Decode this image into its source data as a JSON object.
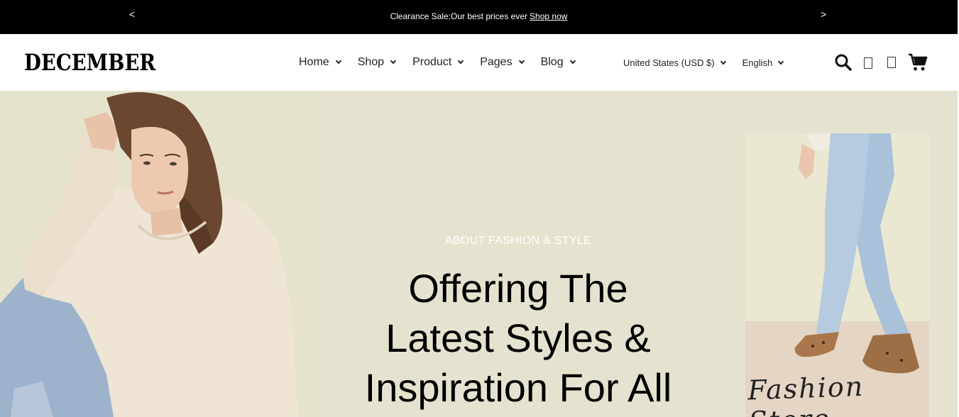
{
  "announcement": {
    "prev_label": "<",
    "next_label": ">",
    "message": "Clearance Sale:Our best prices ever",
    "link": "Shop now"
  },
  "header": {
    "logo": "DECEMBER",
    "nav": [
      {
        "label": "Home"
      },
      {
        "label": "Shop"
      },
      {
        "label": "Product"
      },
      {
        "label": "Pages"
      },
      {
        "label": "Blog"
      }
    ],
    "currency": "United States (USD $)",
    "language": "English",
    "icons": [
      "search-icon",
      "user-icon",
      "heart-icon",
      "cart-icon"
    ]
  },
  "hero": {
    "eyebrow": "ABOUT FASHION & STYLE",
    "headline_lines": [
      "Offering The",
      "Latest Styles &",
      "Inspiration For All"
    ],
    "side_caption": "Fashion Store"
  },
  "colors": {
    "topbar_bg": "#000000",
    "hero_bg": "#e5e3cf",
    "text": "#111111"
  }
}
